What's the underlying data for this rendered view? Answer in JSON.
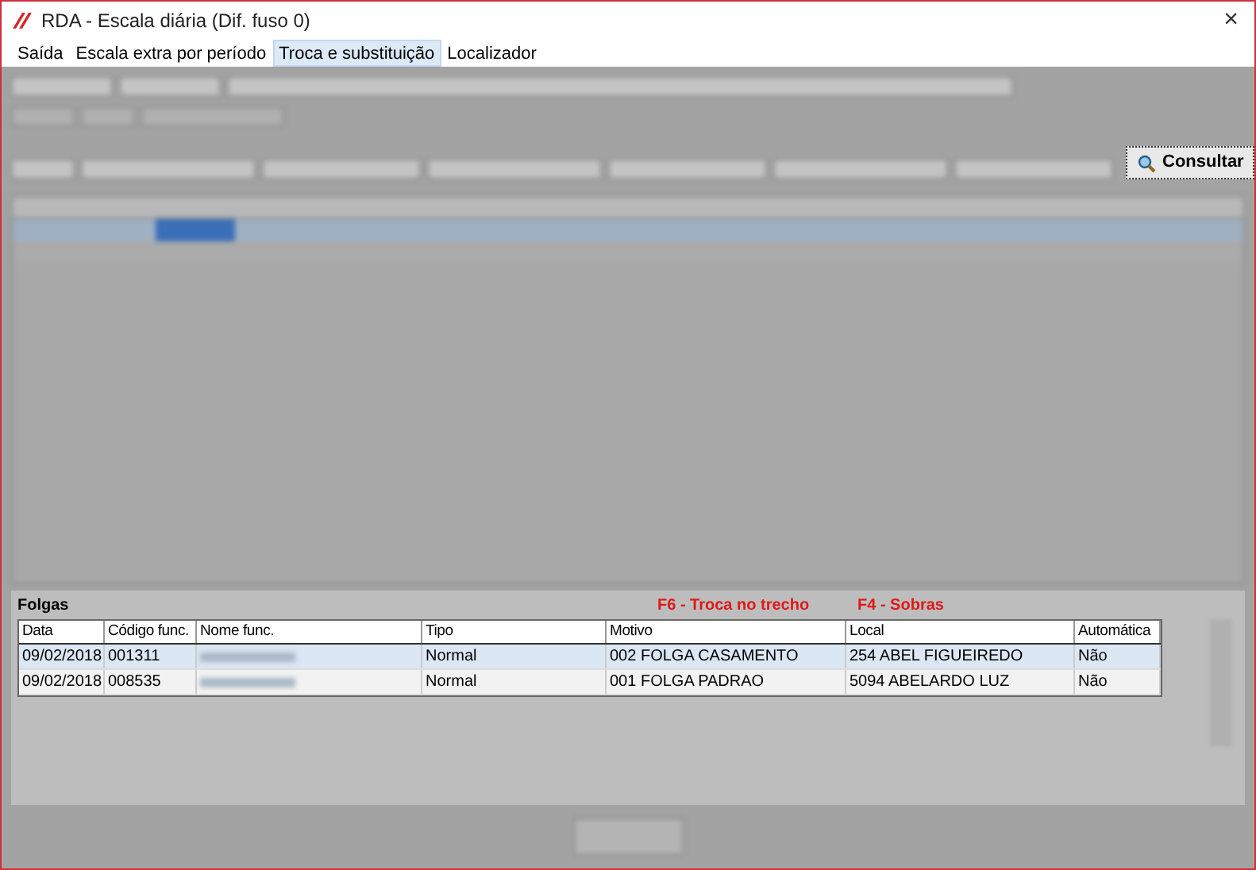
{
  "window": {
    "title": "RDA - Escala diária (Dif. fuso 0)",
    "close": "×"
  },
  "menu": [
    {
      "label": "Saída",
      "selected": false
    },
    {
      "label": "Escala extra por período",
      "selected": false
    },
    {
      "label": "Troca e substituição",
      "selected": true
    },
    {
      "label": "Localizador",
      "selected": false
    }
  ],
  "consultar_button": {
    "label": "Consultar"
  },
  "folgas": {
    "title": "Folgas",
    "shortcuts": [
      "F6 - Troca no trecho",
      "F4 - Sobras"
    ],
    "columns": [
      "Data",
      "Código func.",
      "Nome func.",
      "Tipo",
      "Motivo",
      "Local",
      "Automática"
    ],
    "rows": [
      {
        "selected": true,
        "cells": [
          "09/02/2018",
          "001311",
          null,
          "Normal",
          "002 FOLGA CASAMENTO",
          "254 ABEL FIGUEIREDO",
          "Não"
        ]
      },
      {
        "selected": false,
        "cells": [
          "09/02/2018",
          "008535",
          null,
          "Normal",
          "001 FOLGA PADRAO",
          "5094 ABELARDO LUZ",
          "Não"
        ]
      }
    ]
  }
}
